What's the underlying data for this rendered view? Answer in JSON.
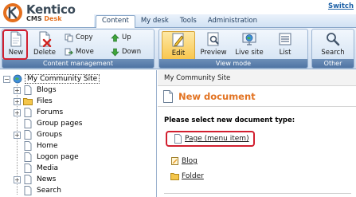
{
  "header": {
    "logo_name": "Kentico",
    "logo_product": "CMS",
    "logo_product_accent": "Desk",
    "switch_label": "Switch",
    "tabs": [
      {
        "label": "Content",
        "active": true
      },
      {
        "label": "My desk",
        "active": false
      },
      {
        "label": "Tools",
        "active": false
      },
      {
        "label": "Administration",
        "active": false
      }
    ]
  },
  "ribbon": {
    "content_management": {
      "caption": "Content management",
      "new_label": "New",
      "delete_label": "Delete",
      "copy_label": "Copy",
      "move_label": "Move",
      "up_label": "Up",
      "down_label": "Down"
    },
    "view_mode": {
      "caption": "View mode",
      "edit_label": "Edit",
      "preview_label": "Preview",
      "live_site_label": "Live site",
      "list_label": "List"
    },
    "other": {
      "caption": "Other",
      "search_label": "Search"
    }
  },
  "tree": {
    "root": "My Community Site",
    "items": [
      {
        "label": "Blogs",
        "expandable": true,
        "icon": "page-icon"
      },
      {
        "label": "Files",
        "expandable": true,
        "icon": "folder-icon"
      },
      {
        "label": "Forums",
        "expandable": true,
        "icon": "page-icon"
      },
      {
        "label": "Group pages",
        "expandable": false,
        "icon": "page-icon"
      },
      {
        "label": "Groups",
        "expandable": true,
        "icon": "page-icon"
      },
      {
        "label": "Home",
        "expandable": false,
        "icon": "page-icon"
      },
      {
        "label": "Logon page",
        "expandable": false,
        "icon": "page-icon"
      },
      {
        "label": "Media",
        "expandable": false,
        "icon": "page-icon"
      },
      {
        "label": "News",
        "expandable": true,
        "icon": "page-icon"
      },
      {
        "label": "Search",
        "expandable": false,
        "icon": "page-icon"
      }
    ]
  },
  "main": {
    "breadcrumb": "My Community Site",
    "title": "New document",
    "prompt": "Please select new document type:",
    "doc_types": [
      {
        "label": "Page (menu item)",
        "icon": "page-icon",
        "highlighted": true
      },
      {
        "label": "Blog",
        "icon": "blog-icon",
        "highlighted": false
      },
      {
        "label": "Folder",
        "icon": "folder-icon",
        "highlighted": false
      }
    ]
  },
  "colors": {
    "accent_orange": "#e27322",
    "highlight_red": "#d21f2f",
    "ribbon_caption": "#4f74a3",
    "link_blue": "#1a5fa6"
  }
}
